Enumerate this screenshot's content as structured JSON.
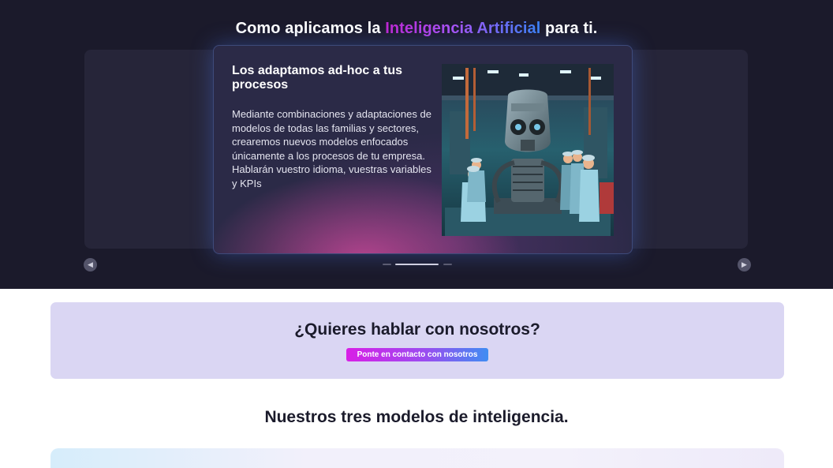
{
  "hero": {
    "title_prefix": "Como aplicamos la ",
    "title_highlight": "Inteligencia Artificial",
    "title_suffix": " para ti."
  },
  "carousel": {
    "active_slide": {
      "title": "Los adaptamos ad-hoc a tus procesos",
      "text": "Mediante combinaciones y adaptaciones de modelos de todas las familias y sectores, crearemos nuevos modelos enfocados únicamente a los procesos de tu empresa. Hablarán vuestro idioma, vuestras variables y KPIs",
      "image_icon": "robot-factory-image"
    },
    "total_slides": 3,
    "active_index": 1,
    "prev_icon": "chevron-left-icon",
    "next_icon": "chevron-right-icon"
  },
  "contact": {
    "title": "¿Quieres hablar con nosotros?",
    "button_label": "Ponte en contacto con nosotros"
  },
  "models": {
    "title": "Nuestros tres modelos de inteligencia."
  },
  "colors": {
    "hero_bg": "#1b1a2b",
    "accent_start": "#d81fe6",
    "accent_end": "#3f8df2",
    "contact_bg": "#dad6f3"
  }
}
